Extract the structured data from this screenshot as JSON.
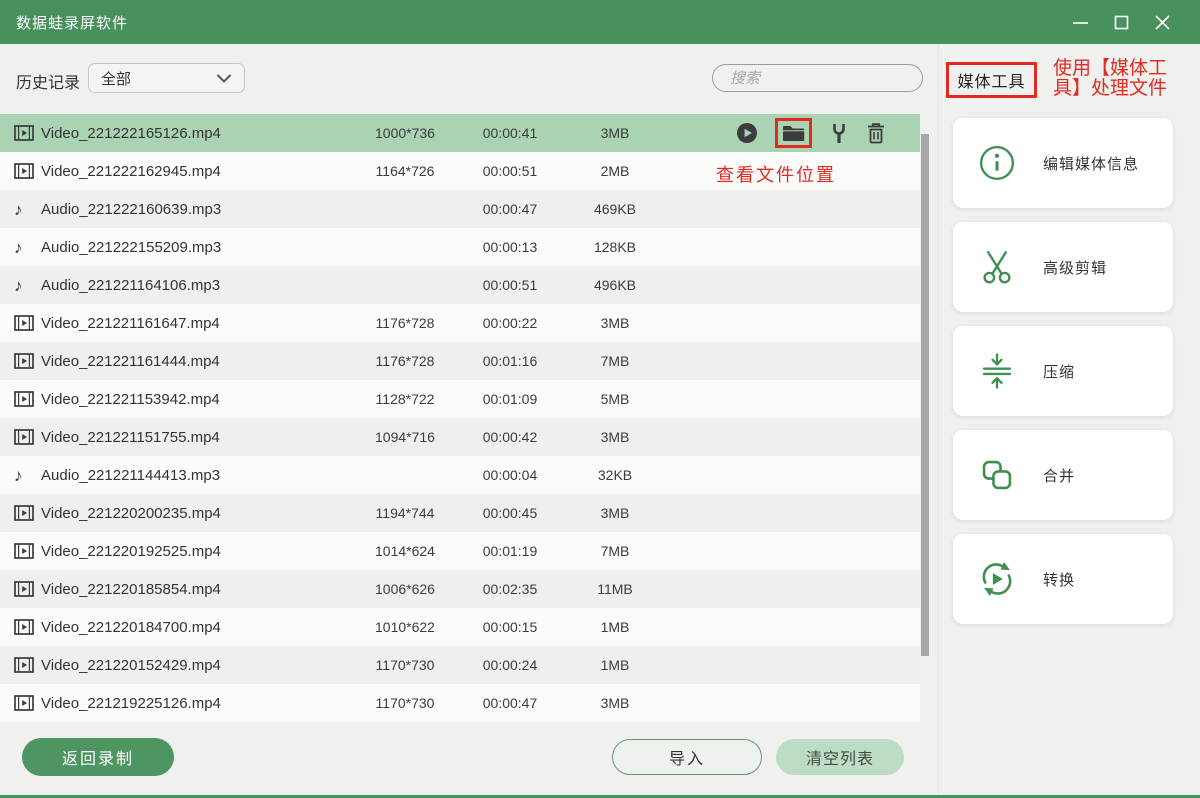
{
  "window": {
    "title": "数据蛙录屏软件"
  },
  "toolbar": {
    "history_label": "历史记录",
    "filter_value": "全部",
    "search_placeholder": "搜索"
  },
  "annotations": {
    "media_tools_callout": [
      "使用【媒体工",
      "具】处理文件"
    ],
    "file_location_callout": "查看文件位置"
  },
  "list": {
    "rows": [
      {
        "type": "video",
        "name": "Video_221222165126.mp4",
        "resolution": "1000*736",
        "duration": "00:00:41",
        "size": "3MB",
        "selected": true,
        "actions": [
          "play",
          "folder",
          "tools",
          "delete"
        ]
      },
      {
        "type": "video",
        "name": "Video_221222162945.mp4",
        "resolution": "1164*726",
        "duration": "00:00:51",
        "size": "2MB"
      },
      {
        "type": "audio",
        "name": "Audio_221222160639.mp3",
        "resolution": "",
        "duration": "00:00:47",
        "size": "469KB"
      },
      {
        "type": "audio",
        "name": "Audio_221222155209.mp3",
        "resolution": "",
        "duration": "00:00:13",
        "size": "128KB"
      },
      {
        "type": "audio",
        "name": "Audio_221221164106.mp3",
        "resolution": "",
        "duration": "00:00:51",
        "size": "496KB"
      },
      {
        "type": "video",
        "name": "Video_221221161647.mp4",
        "resolution": "1176*728",
        "duration": "00:00:22",
        "size": "3MB"
      },
      {
        "type": "video",
        "name": "Video_221221161444.mp4",
        "resolution": "1176*728",
        "duration": "00:01:16",
        "size": "7MB"
      },
      {
        "type": "video",
        "name": "Video_221221153942.mp4",
        "resolution": "1128*722",
        "duration": "00:01:09",
        "size": "5MB"
      },
      {
        "type": "video",
        "name": "Video_221221151755.mp4",
        "resolution": "1094*716",
        "duration": "00:00:42",
        "size": "3MB"
      },
      {
        "type": "audio",
        "name": "Audio_221221144413.mp3",
        "resolution": "",
        "duration": "00:00:04",
        "size": "32KB"
      },
      {
        "type": "video",
        "name": "Video_221220200235.mp4",
        "resolution": "1194*744",
        "duration": "00:00:45",
        "size": "3MB"
      },
      {
        "type": "video",
        "name": "Video_221220192525.mp4",
        "resolution": "1014*624",
        "duration": "00:01:19",
        "size": "7MB"
      },
      {
        "type": "video",
        "name": "Video_221220185854.mp4",
        "resolution": "1006*626",
        "duration": "00:02:35",
        "size": "11MB"
      },
      {
        "type": "video",
        "name": "Video_221220184700.mp4",
        "resolution": "1010*622",
        "duration": "00:00:15",
        "size": "1MB"
      },
      {
        "type": "video",
        "name": "Video_221220152429.mp4",
        "resolution": "1170*730",
        "duration": "00:00:24",
        "size": "1MB"
      },
      {
        "type": "video",
        "name": "Video_221219225126.mp4",
        "resolution": "1170*730",
        "duration": "00:00:47",
        "size": "3MB"
      }
    ]
  },
  "sidebar": {
    "title": "媒体工具",
    "tools": [
      {
        "icon": "info-circle",
        "label": "编辑媒体信息"
      },
      {
        "icon": "scissors",
        "label": "高级剪辑"
      },
      {
        "icon": "compress",
        "label": "压缩"
      },
      {
        "icon": "merge",
        "label": "合并"
      },
      {
        "icon": "convert",
        "label": "转换"
      }
    ]
  },
  "footer": {
    "back_button": "返回录制",
    "import_button": "导入",
    "clear_button": "清空列表"
  },
  "colors": {
    "titlebar_green": "#48905c",
    "selected_row_green": "#a9d3b3",
    "accent_green": "#3f8e52",
    "annotation_red": "#e12b21"
  }
}
